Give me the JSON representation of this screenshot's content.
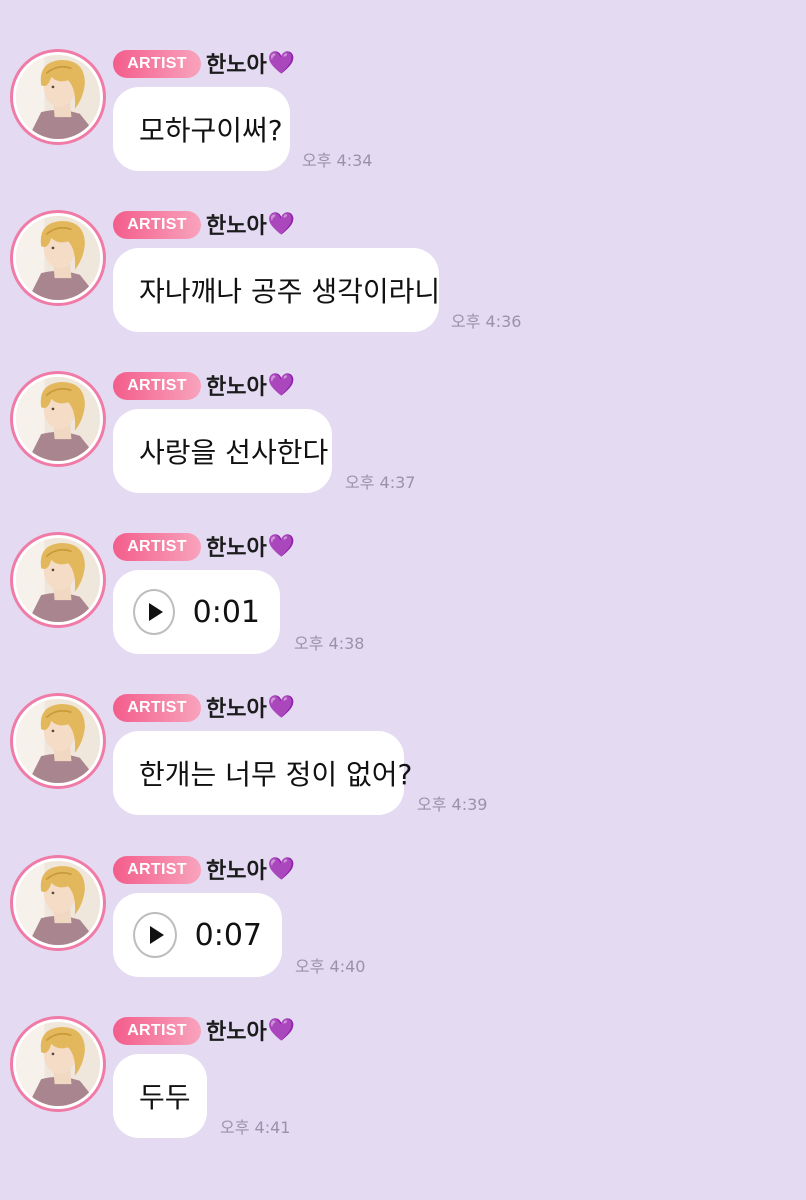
{
  "messages": [
    {
      "badge": "ARTIST",
      "sender": "한노아",
      "heart": "💜",
      "type": "text",
      "text": "모하구이써?",
      "time": "오후 4:34"
    },
    {
      "badge": "ARTIST",
      "sender": "한노아",
      "heart": "💜",
      "type": "text",
      "text": "자나깨나 공주 생각이라니",
      "time": "오후 4:36"
    },
    {
      "badge": "ARTIST",
      "sender": "한노아",
      "heart": "💜",
      "type": "text",
      "text": "사랑을 선사한다",
      "time": "오후 4:37"
    },
    {
      "badge": "ARTIST",
      "sender": "한노아",
      "heart": "💜",
      "type": "voice",
      "text": "0:01",
      "time": "오후 4:38"
    },
    {
      "badge": "ARTIST",
      "sender": "한노아",
      "heart": "💜",
      "type": "text",
      "text": "한개는 너무 정이 없어?",
      "time": "오후 4:39"
    },
    {
      "badge": "ARTIST",
      "sender": "한노아",
      "heart": "💜",
      "type": "voice",
      "text": "0:07",
      "time": "오후 4:40"
    },
    {
      "badge": "ARTIST",
      "sender": "한노아",
      "heart": "💜",
      "type": "text",
      "text": "두두",
      "time": "오후 4:41"
    }
  ],
  "colors": {
    "background": "#e4dbf3",
    "bubble": "#ffffff",
    "badge_start": "#f45d8c",
    "badge_end": "#f8a3bd",
    "avatar_ring": "#f07ba6",
    "heart": "#a64bf0",
    "timestamp": "#9a93a8"
  },
  "icons": {
    "voice": "play-icon",
    "avatar": "artist-avatar"
  }
}
